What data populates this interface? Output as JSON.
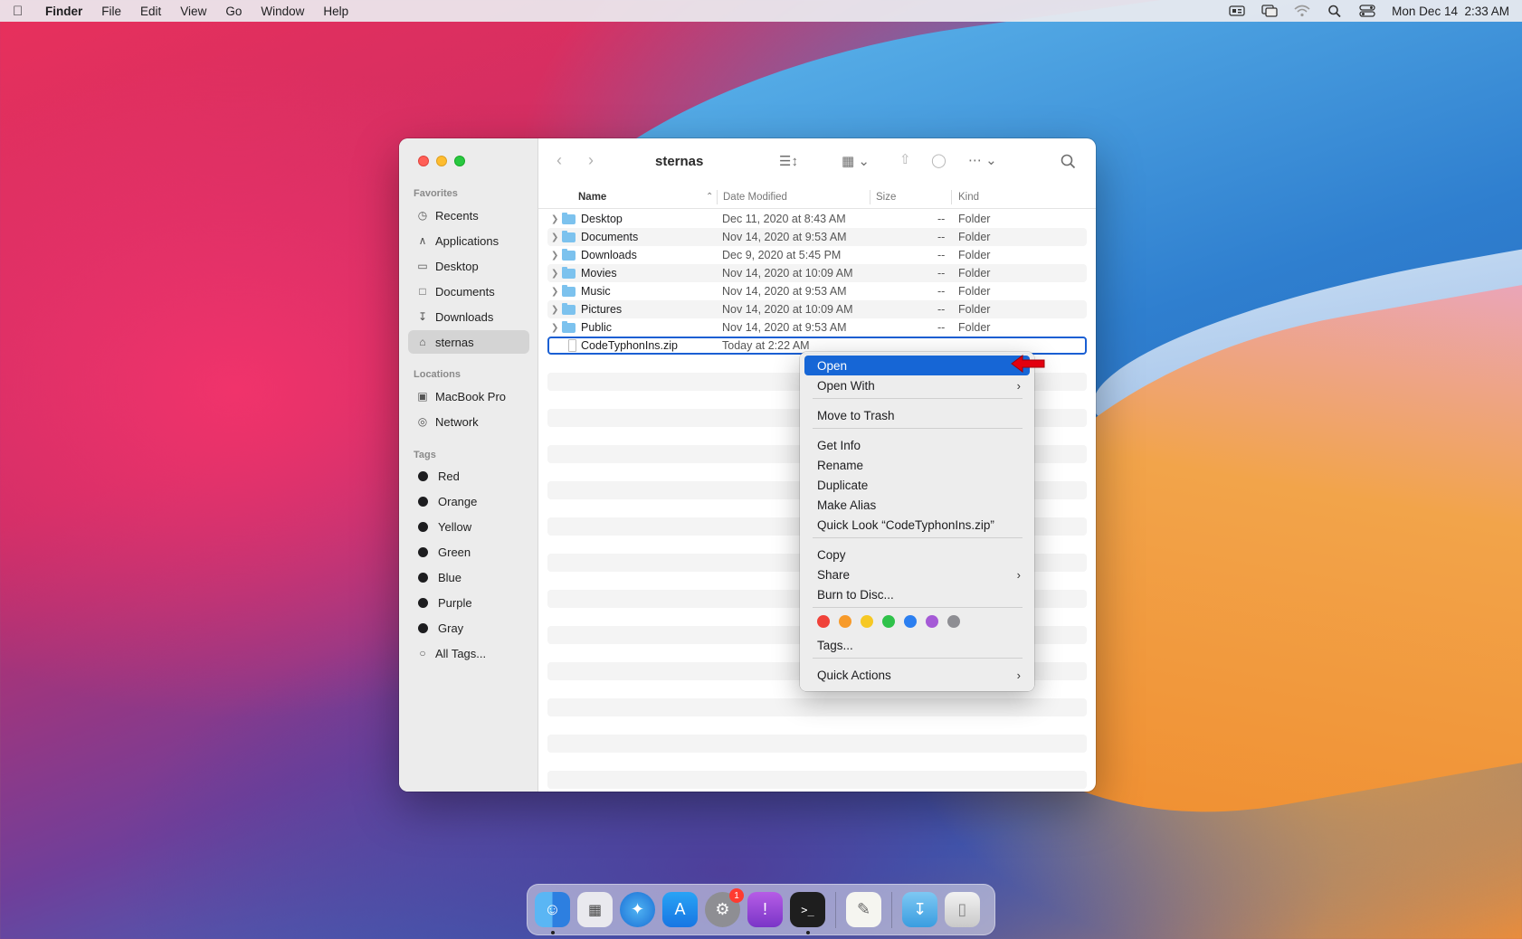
{
  "menubar": {
    "app": "Finder",
    "items": [
      "File",
      "Edit",
      "View",
      "Go",
      "Window",
      "Help"
    ],
    "clock": "Mon Dec 14  2:33 AM"
  },
  "window": {
    "title": "sternas",
    "sidebar": {
      "favorites_label": "Favorites",
      "favorites": [
        {
          "label": "Recents",
          "icon": "clock-icon"
        },
        {
          "label": "Applications",
          "icon": "applications-icon"
        },
        {
          "label": "Desktop",
          "icon": "desktop-icon"
        },
        {
          "label": "Documents",
          "icon": "document-icon"
        },
        {
          "label": "Downloads",
          "icon": "download-icon"
        },
        {
          "label": "sternas",
          "icon": "home-icon"
        }
      ],
      "locations_label": "Locations",
      "locations": [
        {
          "label": "MacBook Pro",
          "icon": "laptop-icon"
        },
        {
          "label": "Network",
          "icon": "globe-icon"
        }
      ],
      "tags_label": "Tags",
      "tags": [
        "Red",
        "Orange",
        "Yellow",
        "Green",
        "Blue",
        "Purple",
        "Gray"
      ],
      "all_tags": "All Tags..."
    },
    "columns": {
      "name": "Name",
      "date": "Date Modified",
      "size": "Size",
      "kind": "Kind"
    },
    "rows": [
      {
        "name": "Desktop",
        "date": "Dec 11, 2020 at 8:43 AM",
        "size": "--",
        "kind": "Folder"
      },
      {
        "name": "Documents",
        "date": "Nov 14, 2020 at 9:53 AM",
        "size": "--",
        "kind": "Folder"
      },
      {
        "name": "Downloads",
        "date": "Dec 9, 2020 at 5:45 PM",
        "size": "--",
        "kind": "Folder"
      },
      {
        "name": "Movies",
        "date": "Nov 14, 2020 at 10:09 AM",
        "size": "--",
        "kind": "Folder"
      },
      {
        "name": "Music",
        "date": "Nov 14, 2020 at 9:53 AM",
        "size": "--",
        "kind": "Folder"
      },
      {
        "name": "Pictures",
        "date": "Nov 14, 2020 at 10:09 AM",
        "size": "--",
        "kind": "Folder"
      },
      {
        "name": "Public",
        "date": "Nov 14, 2020 at 9:53 AM",
        "size": "--",
        "kind": "Folder"
      }
    ],
    "selected_file": {
      "name": "CodeTyphonIns.zip",
      "date": "Today at 2:22 AM"
    }
  },
  "context_menu": {
    "open": "Open",
    "open_with": "Open With",
    "move_to_trash": "Move to Trash",
    "get_info": "Get Info",
    "rename": "Rename",
    "duplicate": "Duplicate",
    "make_alias": "Make Alias",
    "quick_look": "Quick Look “CodeTyphonIns.zip”",
    "copy": "Copy",
    "share": "Share",
    "burn": "Burn to Disc...",
    "tags": "Tags...",
    "quick_actions": "Quick Actions",
    "tag_colors": [
      "#f0423a",
      "#f79a2a",
      "#f6c824",
      "#2fc24a",
      "#2c7ff0",
      "#a55ad6",
      "#8e8e93"
    ]
  },
  "dock": {
    "apps": [
      "finder-icon",
      "launchpad-icon",
      "safari-icon",
      "app-store-icon",
      "system-preferences-icon",
      "feedback-icon",
      "terminal-icon",
      "textedit-icon",
      "downloads-folder-icon",
      "trash-icon"
    ],
    "badge": "1"
  }
}
